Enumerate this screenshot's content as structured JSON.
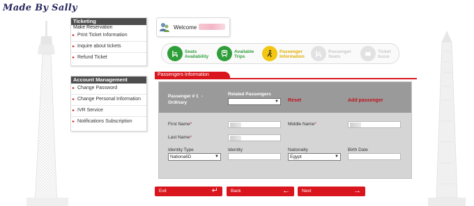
{
  "watermark": "Made By Sally",
  "sidebar": {
    "ticketing": {
      "title": "Ticketing",
      "subtitle": "Make Reservation",
      "items": [
        {
          "label": "Print Ticket Information"
        },
        {
          "label": "Inquire about tickets"
        },
        {
          "label": "Refund Ticket"
        }
      ]
    },
    "account": {
      "title": "Account Management",
      "items": [
        {
          "label": "Change Password"
        },
        {
          "label": "Change Personal Information"
        },
        {
          "label": "IVR Service"
        },
        {
          "label": "Notifications Subscription"
        }
      ]
    }
  },
  "welcome": {
    "label": "Welcome"
  },
  "steps": [
    {
      "label": "Seats\nAvailability",
      "state": "done",
      "icon": "seat-icon"
    },
    {
      "label": "Available\nTrips",
      "state": "done",
      "icon": "train-icon"
    },
    {
      "label": "Passenger\nInformation",
      "state": "current",
      "icon": "walking-person-icon"
    },
    {
      "label": "Passenger\nSeats",
      "state": "todo",
      "icon": "seat-icon"
    },
    {
      "label": "Ticket\nIssue",
      "state": "todo",
      "icon": "ticket-icon"
    }
  ],
  "section": {
    "title": "Passengers Information"
  },
  "passenger": {
    "heading": "Passenger # 1",
    "dash": "-",
    "type": "Ordinary",
    "related_label": "Related Passengers",
    "related_value": "",
    "reset": "Reset",
    "add": "Add passenger"
  },
  "form": {
    "first_name": "First Name",
    "middle_name": "Middle Name",
    "last_name": "Last Name",
    "identity_type": "Identity Type",
    "identity_type_value": "NationalID",
    "identity": "Identity",
    "nationality": "Nationalty",
    "nationality_value": "Egypt",
    "birth_date": "Birth Date",
    "required_mark": "*"
  },
  "buttons": {
    "exit": "Exit",
    "back": "Back",
    "next": "Next"
  },
  "colors": {
    "accent_red": "#d9161e",
    "step_done": "#2f9e3a",
    "step_current": "#f2c611",
    "step_todo": "#e2e2e2"
  }
}
